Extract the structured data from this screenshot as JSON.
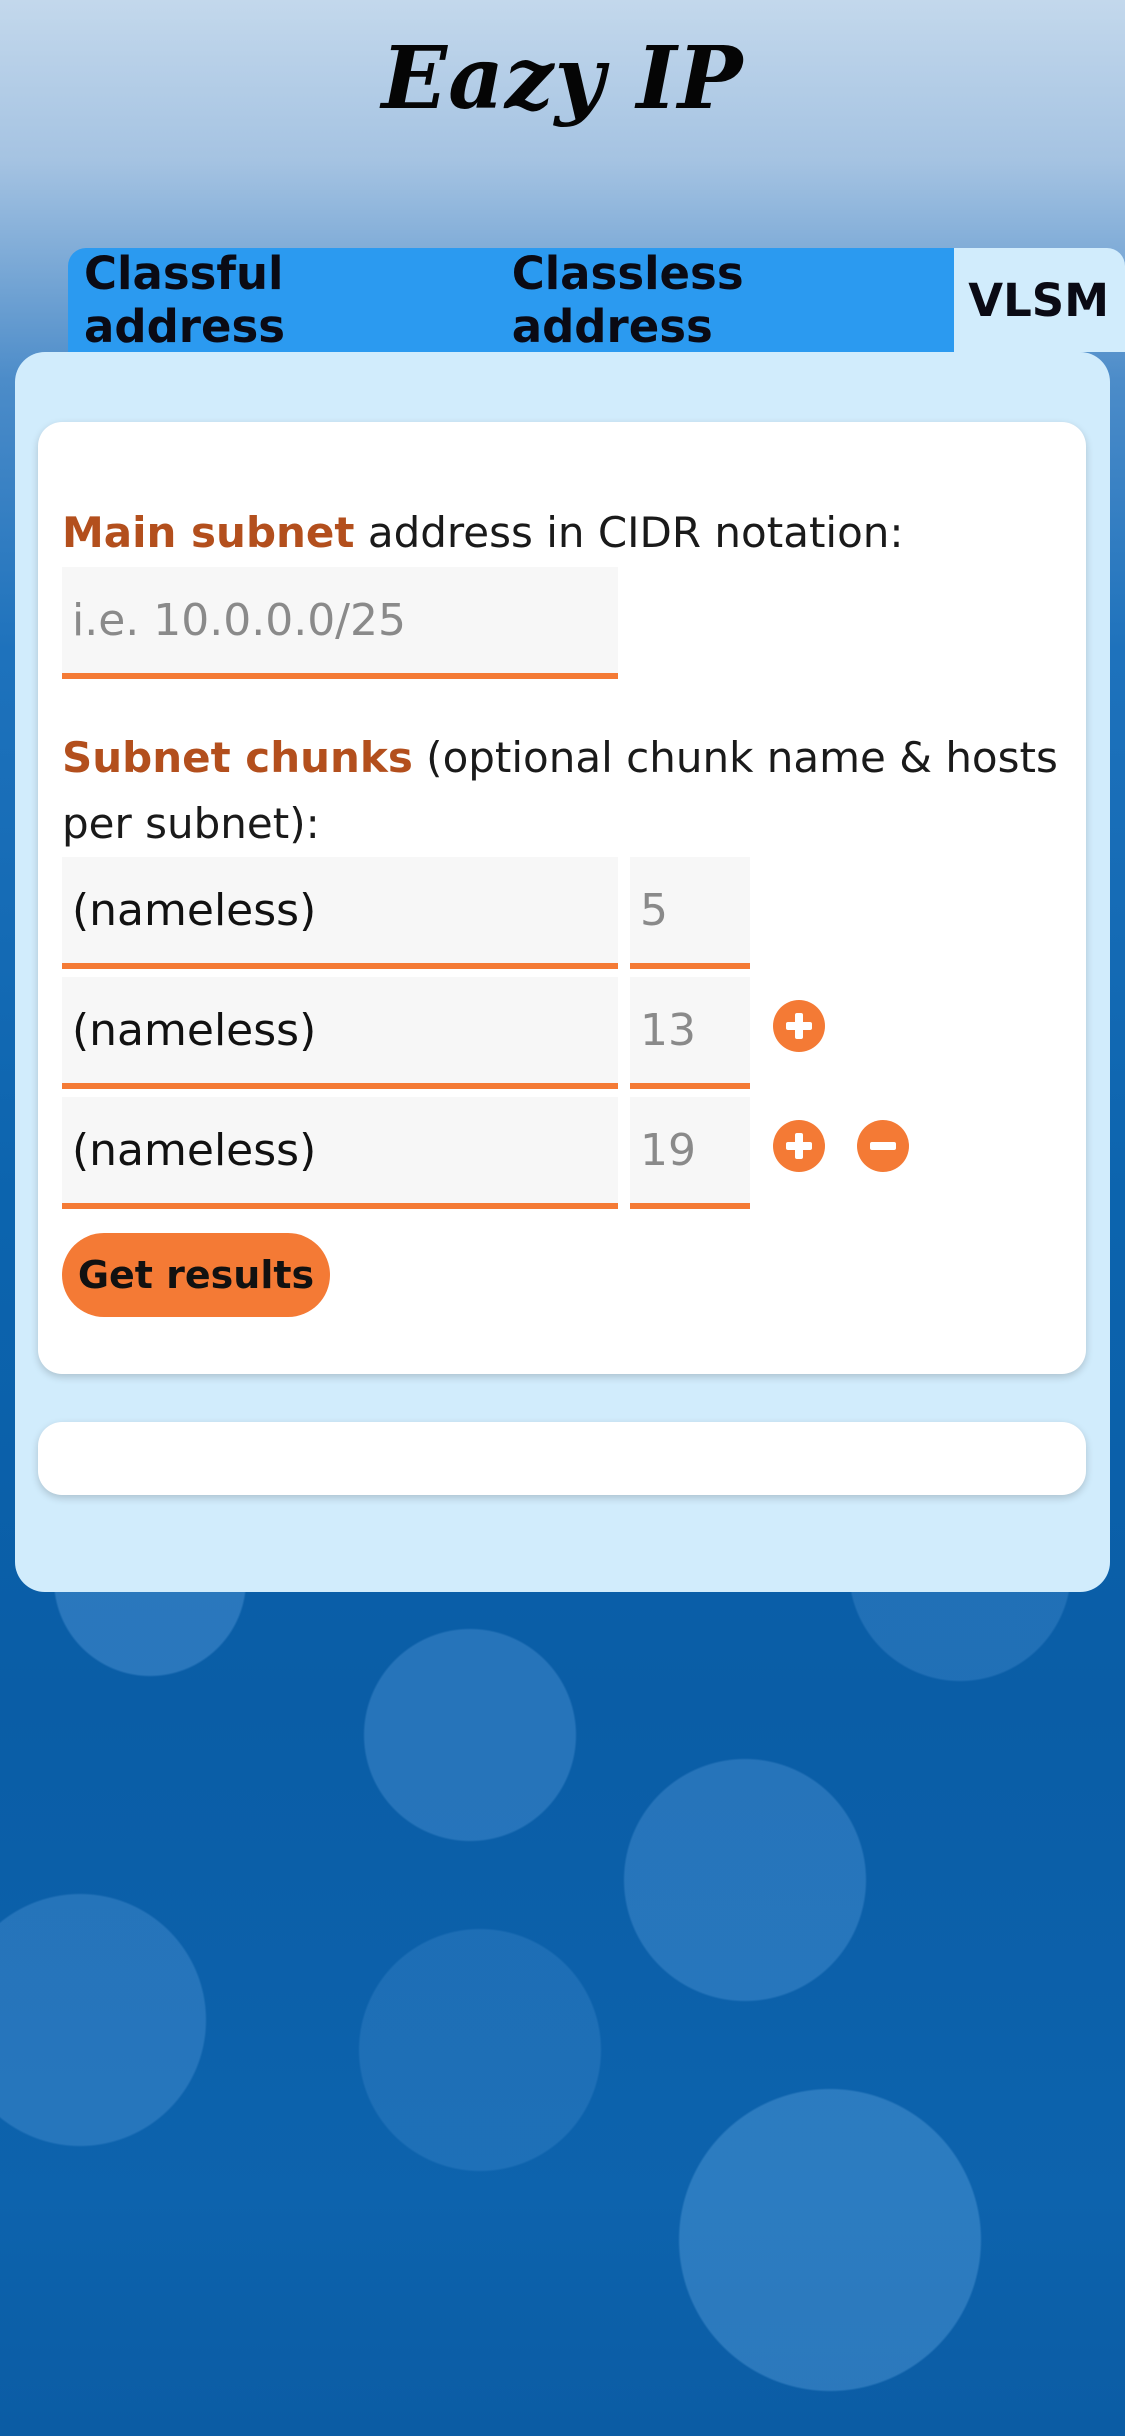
{
  "app": {
    "title": "Eazy IP"
  },
  "tabs": [
    {
      "label": "Classful address"
    },
    {
      "label": "Classless address"
    },
    {
      "label": "VLSM",
      "active": true
    }
  ],
  "form": {
    "main_subnet": {
      "label_highlight": "Main subnet",
      "label_rest": " address in CIDR notation:",
      "placeholder": "i.e. 10.0.0.0/25",
      "value": ""
    },
    "chunks": {
      "label_highlight": "Subnet chunks",
      "label_rest": " (optional chunk name & hosts per subnet):",
      "rows": [
        {
          "name": "(nameless)",
          "hosts_placeholder": "5",
          "buttons": []
        },
        {
          "name": "(nameless)",
          "hosts_placeholder": "13",
          "buttons": [
            "add"
          ]
        },
        {
          "name": "(nameless)",
          "hosts_placeholder": "19",
          "buttons": [
            "add",
            "remove"
          ]
        }
      ]
    },
    "submit_label": "Get results"
  },
  "colors": {
    "accent": "#f47a35",
    "tab_bg": "#2b9af0",
    "panel_bg": "#d1ecfc",
    "label_highlight": "#b34f1d"
  },
  "icons": {
    "add": "plus-circle-icon",
    "remove": "minus-circle-icon"
  }
}
